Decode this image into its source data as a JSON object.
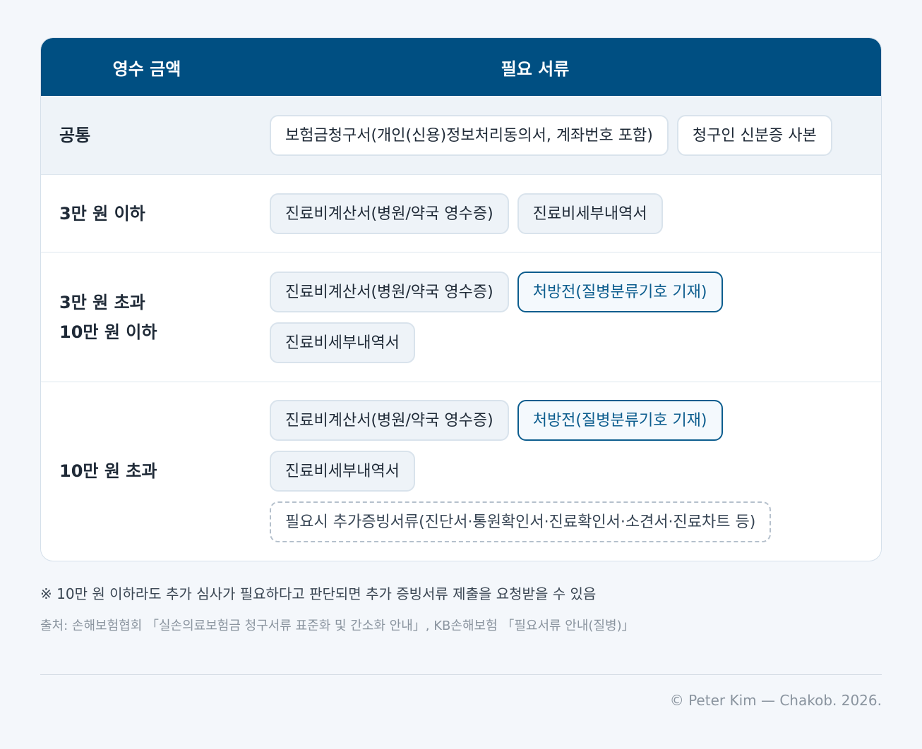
{
  "header": {
    "amount": "영수 금액",
    "docs": "필요 서류"
  },
  "rows": [
    {
      "label": [
        "공통"
      ],
      "docs": [
        {
          "text": "보험금청구서(개인(신용)정보처리동의서, 계좌번호 포함)",
          "style": "normal"
        },
        {
          "text": "청구인 신분증 사본",
          "style": "normal"
        }
      ]
    },
    {
      "label": [
        "3만 원 이하"
      ],
      "docs": [
        {
          "text": "진료비계산서(병원/약국 영수증)",
          "style": "normal"
        },
        {
          "text": "진료비세부내역서",
          "style": "normal"
        }
      ]
    },
    {
      "label": [
        "3만 원 초과",
        "10만 원 이하"
      ],
      "docs": [
        {
          "text": "진료비계산서(병원/약국 영수증)",
          "style": "normal"
        },
        {
          "text": "처방전(질병분류기호 기재)",
          "style": "highlight"
        },
        {
          "text": "진료비세부내역서",
          "style": "normal"
        }
      ]
    },
    {
      "label": [
        "10만 원 초과"
      ],
      "docs": [
        {
          "text": "진료비계산서(병원/약국 영수증)",
          "style": "normal"
        },
        {
          "text": "처방전(질병분류기호 기재)",
          "style": "highlight"
        },
        {
          "text": "진료비세부내역서",
          "style": "normal"
        },
        {
          "text": "필요시 추가증빙서류(진단서·통원확인서·진료확인서·소견서·진료차트 등)",
          "style": "dashed"
        }
      ]
    }
  ],
  "note": "※ 10만 원 이하라도 추가 심사가 필요하다고 판단되면 추가 증빙서류 제출을 요청받을 수 있음",
  "source": "출처: 손해보험협회 「실손의료보험금 청구서류 표준화 및 간소화 안내」, KB손해보험 「필요서류 안내(질병)」",
  "footer": "© Peter Kim — Chakob. 2026.",
  "colors": {
    "header_bg": "#004f82",
    "accent": "#0c5d8e",
    "page_bg": "#f4f7fb"
  }
}
